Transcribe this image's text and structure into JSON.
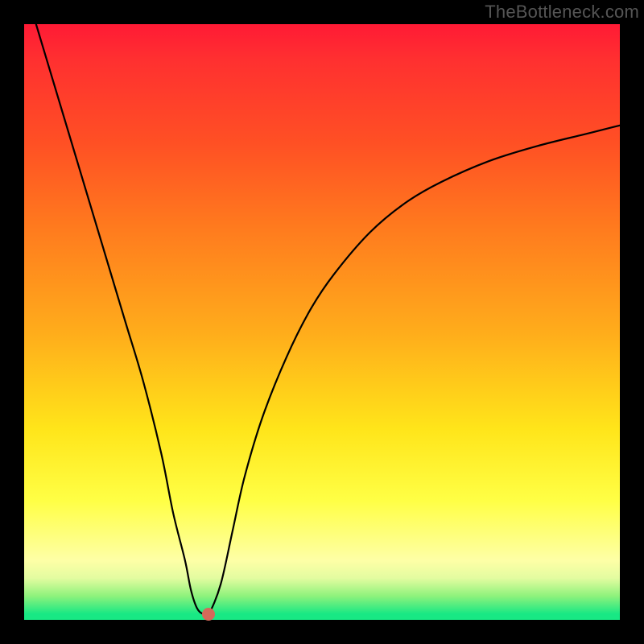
{
  "watermark": "TheBottleneck.com",
  "chart_data": {
    "type": "line",
    "title": "",
    "xlabel": "",
    "ylabel": "",
    "xlim": [
      0,
      100
    ],
    "ylim": [
      0,
      100
    ],
    "grid": false,
    "series": [
      {
        "name": "bottleneck-curve",
        "x": [
          2,
          5,
          8,
          11,
          14,
          17,
          20,
          23,
          25,
          27,
          28,
          29,
          30,
          31,
          33,
          35,
          37,
          40,
          44,
          48,
          52,
          58,
          64,
          70,
          78,
          86,
          94,
          100
        ],
        "y": [
          100,
          90,
          80,
          70,
          60,
          50,
          40,
          28,
          18,
          10,
          5,
          2,
          1,
          1,
          6,
          15,
          24,
          34,
          44,
          52,
          58,
          65,
          70,
          73.5,
          77,
          79.5,
          81.5,
          83
        ]
      }
    ],
    "marker": {
      "name": "optimal-point",
      "x": 31,
      "y": 1,
      "color": "#d46a5a"
    },
    "background_gradient": {
      "from": "#ff1a35",
      "to": "#18e884",
      "stops": [
        "#ff1a35",
        "#ff7a1e",
        "#ffe51a",
        "#feffa6",
        "#18e884"
      ]
    }
  }
}
